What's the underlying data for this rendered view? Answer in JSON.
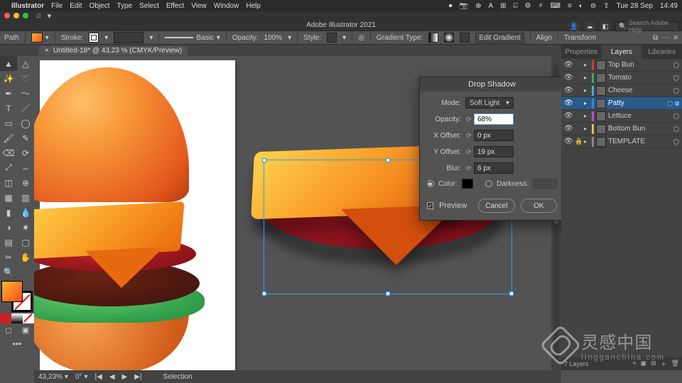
{
  "mac_menu": {
    "app": "Illustrator",
    "items": [
      "File",
      "Edit",
      "Object",
      "Type",
      "Select",
      "Effect",
      "View",
      "Window",
      "Help"
    ],
    "right_status": [
      "⏺",
      "📷",
      "⊕",
      "A",
      "⊞",
      "⍇",
      "⚙",
      "⚡︎",
      "⌨︎",
      "≡",
      "◐",
      "⊜",
      "⇪",
      "Tue 28 Sep",
      "14:49"
    ]
  },
  "app_title": "Adobe Illustrator 2021",
  "options_bar": {
    "label_path": "Path",
    "fill_label": "Fill",
    "stroke_label": "Stroke:",
    "stroke_weight": "",
    "brush_style": "Basic",
    "opacity_label": "Opacity:",
    "opacity_value": "100%",
    "style_label": "Style:",
    "gradient_type_label": "Gradient Type:",
    "edit_gradient": "Edit Gradient",
    "align_label": "Align",
    "transform_label": "Transform",
    "search_help_placeholder": "Search Adobe Help"
  },
  "doc_tab": {
    "close": "×",
    "title": "Untitled-18* @ 43,23 % (CMYK/Preview)"
  },
  "tools": {
    "edit_toolbar": "•••"
  },
  "dialog": {
    "title": "Drop Shadow",
    "mode_label": "Mode:",
    "mode_value": "Soft Light",
    "opacity_label": "Opacity:",
    "opacity_value": "68%",
    "xoffset_label": "X Offset:",
    "xoffset_value": "0 px",
    "yoffset_label": "Y Offset:",
    "yoffset_value": "19 px",
    "blur_label": "Blur:",
    "blur_value": "6 px",
    "color_label": "Color:",
    "darkness_label": "Darkness:",
    "preview_label": "Preview",
    "cancel": "Cancel",
    "ok": "OK"
  },
  "panels": {
    "tabs": [
      "Properties",
      "Layers",
      "Libraries"
    ],
    "active_tab": 1,
    "layers": [
      {
        "name": "Top Bun",
        "color": "#d33",
        "visible": true,
        "locked": false,
        "selected": false
      },
      {
        "name": "Tomato",
        "color": "#4a4",
        "visible": true,
        "locked": false,
        "selected": false
      },
      {
        "name": "Cheese",
        "color": "#4ad",
        "visible": true,
        "locked": false,
        "selected": false
      },
      {
        "name": "Patty",
        "color": "#38c",
        "visible": true,
        "locked": false,
        "selected": true
      },
      {
        "name": "Lettuce",
        "color": "#c4c",
        "visible": true,
        "locked": false,
        "selected": false
      },
      {
        "name": "Bottom Bun",
        "color": "#cc4",
        "visible": true,
        "locked": false,
        "selected": false
      },
      {
        "name": "TEMPLATE",
        "color": "#888",
        "visible": true,
        "locked": true,
        "selected": false
      }
    ],
    "footer": {
      "count": "7 Layers"
    }
  },
  "status_bar": {
    "zoom": "43,23%",
    "rotate": "0°",
    "tool_hint": "Selection"
  },
  "watermark": {
    "main": "灵感中国",
    "sub": "lingganchina.com"
  }
}
